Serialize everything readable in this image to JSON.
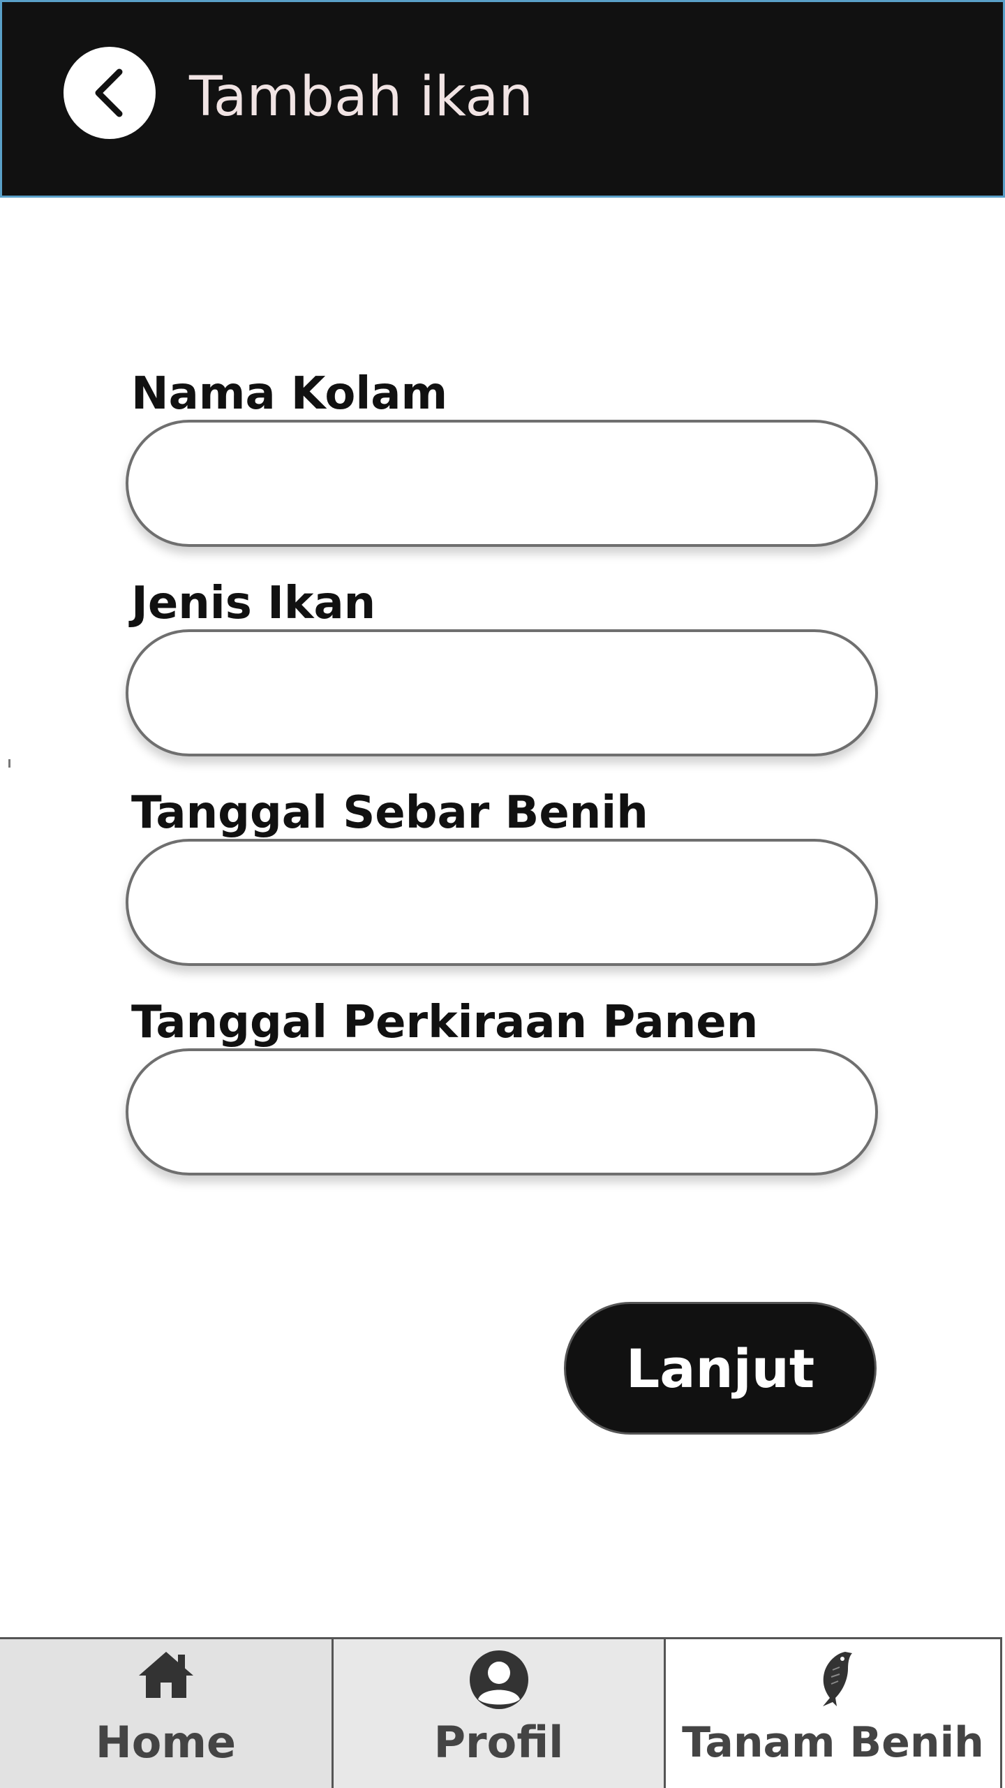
{
  "header": {
    "title": "Tambah ikan",
    "background": "#111111",
    "border_color": "#5aa0c8",
    "back_icon": "chevron-left-icon"
  },
  "form": {
    "fields": [
      {
        "label": "Nama Kolam",
        "value": "",
        "placeholder": ""
      },
      {
        "label": "Jenis Ikan",
        "value": "",
        "placeholder": ""
      },
      {
        "label": "Tanggal Sebar Benih",
        "value": "",
        "placeholder": ""
      },
      {
        "label": "Tanggal Perkiraan Panen",
        "value": "",
        "placeholder": ""
      }
    ],
    "submit_label": "Lanjut"
  },
  "bottom_nav": {
    "items": [
      {
        "label": "Home",
        "icon": "home-icon"
      },
      {
        "label": "Profil",
        "icon": "user-avatar-icon"
      },
      {
        "label": "Tanam Benih",
        "icon": "fish-icon",
        "active": true
      }
    ]
  }
}
